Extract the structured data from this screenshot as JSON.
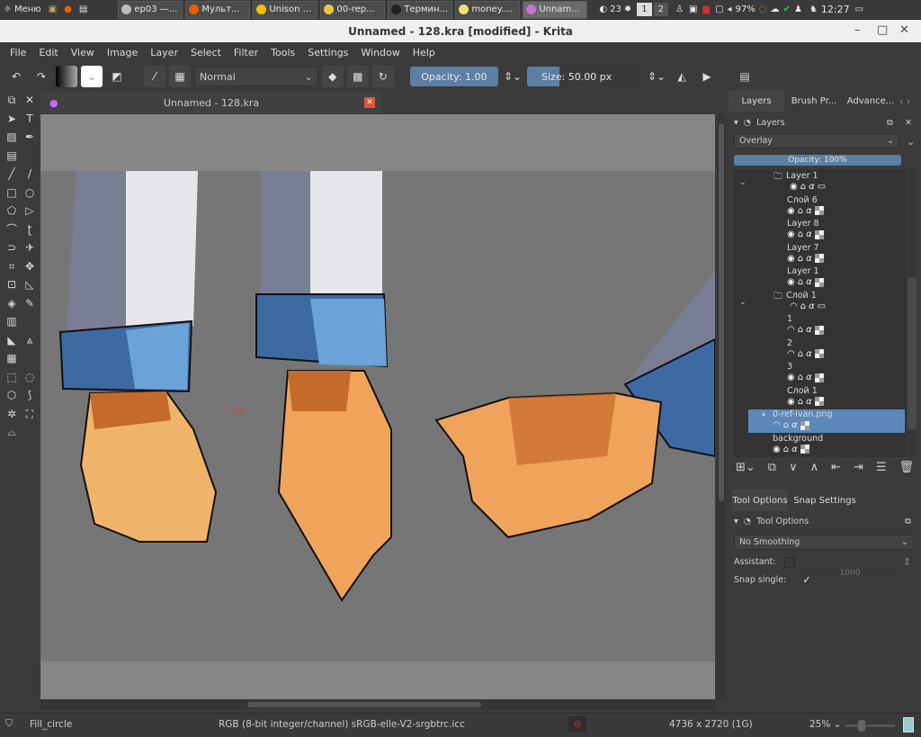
{
  "taskbar": {
    "menu_label": "Меню",
    "tasks": [
      {
        "label": "ep03 —...",
        "color": "#bbbbbb"
      },
      {
        "label": "Мульт...",
        "color": "#e66000"
      },
      {
        "label": "Unison ...",
        "color": "#f0c000"
      },
      {
        "label": "00-rep...",
        "color": "#e8c840"
      },
      {
        "label": "Термин...",
        "color": "#222222"
      },
      {
        "label": "money....",
        "color": "#f0e070"
      },
      {
        "label": "Unnam...",
        "color": "#d070d0",
        "active": true
      }
    ],
    "count": "23",
    "workspaces": [
      "1",
      "2"
    ],
    "battery": "97%",
    "clock": "12:27"
  },
  "window": {
    "title": "Unnamed - 128.kra [modified] - Krita"
  },
  "menu": [
    "File",
    "Edit",
    "View",
    "Image",
    "Layer",
    "Select",
    "Filter",
    "Tools",
    "Settings",
    "Window",
    "Help"
  ],
  "toolbar": {
    "blend_mode": "Normal",
    "opacity_label": "Opacity:  1.00",
    "opacity_value": 1.0,
    "size_label": "Size:  50.00 px",
    "size_value": 50
  },
  "document_tab": {
    "title": "Unnamed - 128.kra"
  },
  "dock_tabs": [
    "Layers",
    "Brush Pr...",
    "Advance..."
  ],
  "layers_panel": {
    "title": "Layers",
    "blend_mode": "Overlay",
    "opacity_label": "Opacity:  100%",
    "opacity_value": 100,
    "layers": [
      {
        "name": "Layer 1",
        "type": "group",
        "visible": true,
        "depth": 1
      },
      {
        "name": "Слой 6",
        "type": "paint",
        "visible": true,
        "depth": 2
      },
      {
        "name": "Layer 8",
        "type": "paint",
        "visible": true,
        "depth": 2,
        "alpha_locked": true
      },
      {
        "name": "Layer 7",
        "type": "paint",
        "visible": true,
        "depth": 2,
        "alpha_locked": true
      },
      {
        "name": "Layer 1",
        "type": "paint",
        "visible": true,
        "depth": 2
      },
      {
        "name": "Слой 1",
        "type": "group",
        "visible": false,
        "depth": 1
      },
      {
        "name": "1",
        "type": "paint",
        "visible": false,
        "depth": 2
      },
      {
        "name": "2",
        "type": "paint",
        "visible": false,
        "depth": 2
      },
      {
        "name": "3",
        "type": "paint",
        "visible": true,
        "depth": 2
      },
      {
        "name": "Слой 1",
        "type": "paint",
        "visible": true,
        "depth": 2
      },
      {
        "name": "0-ref-ivan.png",
        "type": "file",
        "visible": false,
        "depth": 0,
        "selected": true
      },
      {
        "name": "background",
        "type": "paint",
        "visible": true,
        "depth": 0
      }
    ]
  },
  "tool_options": {
    "tabs": [
      "Tool Options",
      "Snap Settings"
    ],
    "title": "Tool Options",
    "smoothing": "No Smoothing",
    "assistant_label": "Assistant:",
    "assistant_value": "1000",
    "snap_label": "Snap single:",
    "snap_checked": true
  },
  "status": {
    "tool": "Fill_circle",
    "color_space": "RGB (8-bit integer/channel)  sRGB-elle-V2-srgbtrc.icc",
    "dimensions": "4736 x 2720 (1G)",
    "zoom": "25%"
  },
  "colors": {
    "accent": "#5c7fa3",
    "selection": "#5b88b8",
    "canvas": "#7a7a7a",
    "sleeve": "#3d6aa3",
    "skin": "#e89a50"
  }
}
